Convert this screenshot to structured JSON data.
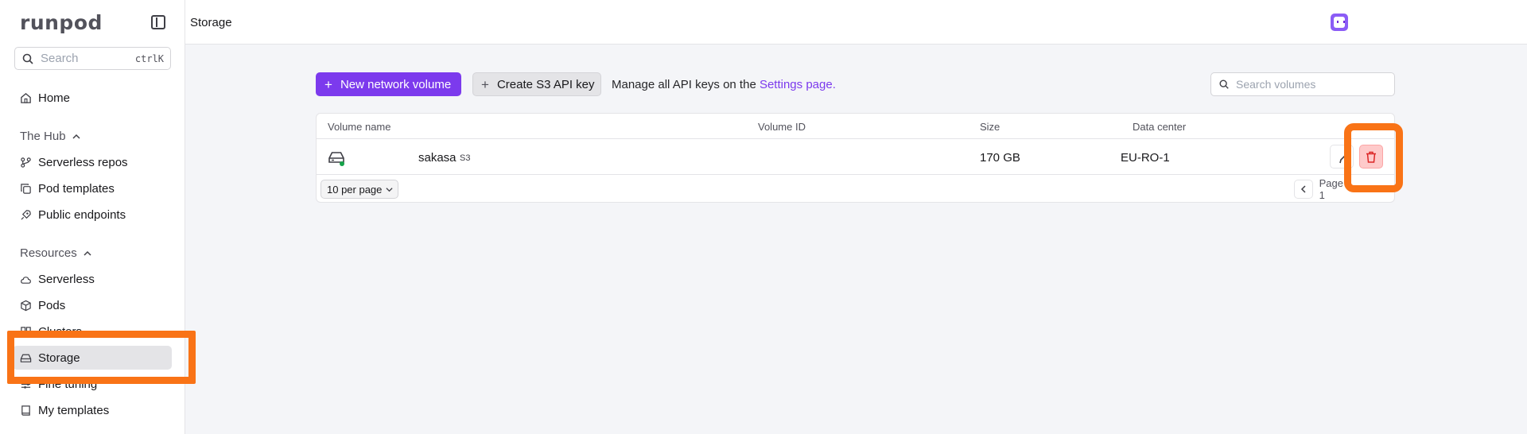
{
  "app": {
    "logo": "runpod",
    "breadcrumb": "Storage"
  },
  "sidebar": {
    "search": {
      "placeholder": "Search",
      "shortcut": "ctrlK"
    },
    "home": "Home",
    "hub_section": "The Hub",
    "hub_items": [
      "Serverless repos",
      "Pod templates",
      "Public endpoints"
    ],
    "resources_section": "Resources",
    "resource_items": [
      "Serverless",
      "Pods",
      "Clusters",
      "Storage",
      "Fine tuning",
      "My templates"
    ],
    "active_item": "Storage"
  },
  "toolbar": {
    "new_volume_label": "New network volume",
    "create_s3_label": "Create S3 API key",
    "manage_text": "Manage all API keys on the ",
    "settings_link": "Settings page.",
    "search_placeholder": "Search volumes"
  },
  "table": {
    "columns": [
      "Volume name",
      "Volume ID",
      "Size",
      "Data center"
    ],
    "rows": [
      {
        "name": "sakasa",
        "tag": "S3",
        "volume_id": "",
        "size": "170 GB",
        "data_center": "EU-RO-1",
        "status": "online"
      }
    ],
    "per_page": "10 per page",
    "page_label": "Page 1"
  },
  "colors": {
    "accent": "#7c3aed",
    "status_online": "#16a34a",
    "delete_bg": "#fecaca",
    "highlight": "#f97316"
  },
  "icons": {
    "home": "home-icon",
    "serverless_repos": "repo-icon",
    "pod_templates": "copy-icon",
    "public_endpoints": "rocket-icon",
    "serverless": "cloud-icon",
    "pods": "cube-icon",
    "clusters": "cluster-icon",
    "storage": "drive-icon",
    "fine_tuning": "sliders-icon",
    "my_templates": "book-icon",
    "delete": "trash-icon",
    "edit": "pencil-icon"
  }
}
